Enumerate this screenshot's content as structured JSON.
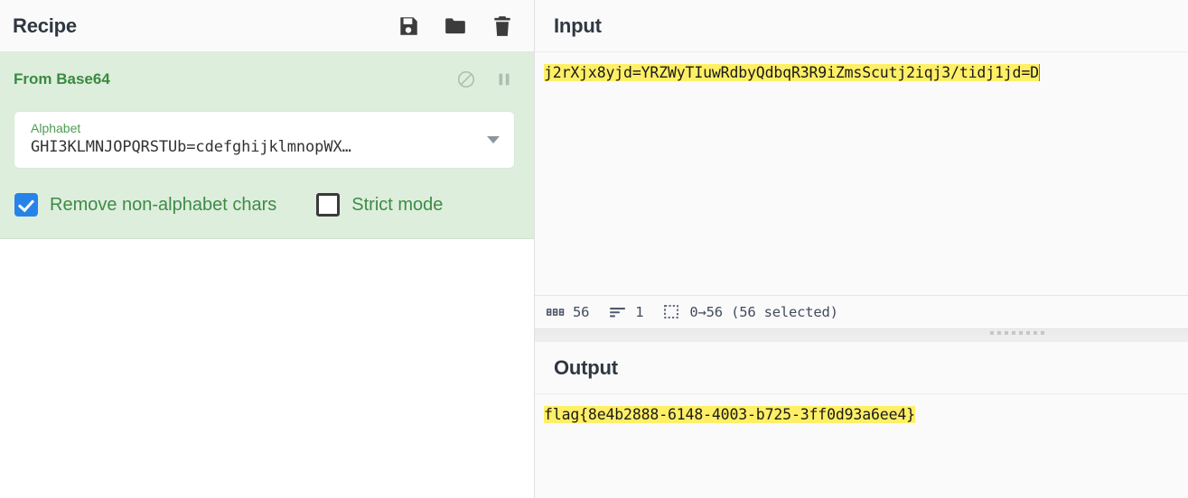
{
  "recipe": {
    "title": "Recipe",
    "toolbar": [
      {
        "name": "save-recipe-icon",
        "label": "Save recipe"
      },
      {
        "name": "load-recipe-icon",
        "label": "Load recipe"
      },
      {
        "name": "clear-recipe-icon",
        "label": "Clear recipe"
      }
    ],
    "operation": {
      "name": "From Base64",
      "disable_icon_label": "Disable operation",
      "breakpoint_icon_label": "Set breakpoint",
      "arg": {
        "label": "Alphabet",
        "value": "GHI3KLMNJOPQRSTUb=cdefghijklmnopWX…"
      },
      "checkboxes": [
        {
          "label": "Remove non-alphabet chars",
          "checked": true
        },
        {
          "label": "Strict mode",
          "checked": false
        }
      ]
    }
  },
  "input": {
    "title": "Input",
    "text": "j2rXjx8yjd=YRZWyTIuwRdbyQdbqR3R9iZmsScutj2iqj3/tidj1jd=D",
    "status": {
      "length_label": "56",
      "lines_label": "1",
      "selection_label": "0→56 (56 selected)"
    }
  },
  "output": {
    "title": "Output",
    "text": "flag{8e4b2888-6148-4003-b725-3ff0d93a6ee4}"
  },
  "colors": {
    "operation_bg": "#ddeedd",
    "operation_name": "#3a8a3f",
    "highlight": "#ffef66",
    "checkbox_checked": "#2684e8"
  }
}
